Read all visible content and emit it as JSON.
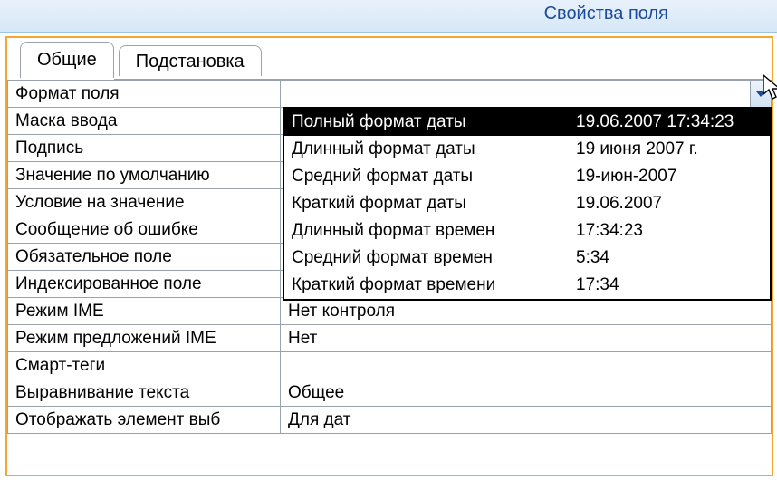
{
  "header": {
    "title": "Свойства поля"
  },
  "tabs": [
    {
      "label": "Общие",
      "active": true
    },
    {
      "label": "Подстановка",
      "active": false
    }
  ],
  "properties": [
    {
      "label": "Формат поля",
      "value": ""
    },
    {
      "label": "Маска ввода",
      "value": ""
    },
    {
      "label": "Подпись",
      "value": ""
    },
    {
      "label": "Значение по умолчанию",
      "value": ""
    },
    {
      "label": "Условие на значение",
      "value": ""
    },
    {
      "label": "Сообщение об ошибке",
      "value": ""
    },
    {
      "label": "Обязательное поле",
      "value": ""
    },
    {
      "label": "Индексированное поле",
      "value": ""
    },
    {
      "label": "Режим IME",
      "value": "Нет контроля"
    },
    {
      "label": "Режим предложений IME",
      "value": "Нет"
    },
    {
      "label": "Смарт-теги",
      "value": ""
    },
    {
      "label": "Выравнивание текста",
      "value": "Общее"
    },
    {
      "label": "Отображать элемент выб",
      "value": "Для дат"
    }
  ],
  "dropdown": {
    "selected_index": 0,
    "options": [
      {
        "name": "Полный формат даты",
        "example": "19.06.2007 17:34:23"
      },
      {
        "name": "Длинный формат даты",
        "example": "19 июня 2007 г."
      },
      {
        "name": "Средний формат даты",
        "example": "19-июн-2007"
      },
      {
        "name": "Краткий формат даты",
        "example": "19.06.2007"
      },
      {
        "name": "Длинный формат времен",
        "example": "17:34:23"
      },
      {
        "name": "Средний формат времен",
        "example": "5:34"
      },
      {
        "name": "Краткий формат времени",
        "example": "17:34"
      }
    ]
  }
}
